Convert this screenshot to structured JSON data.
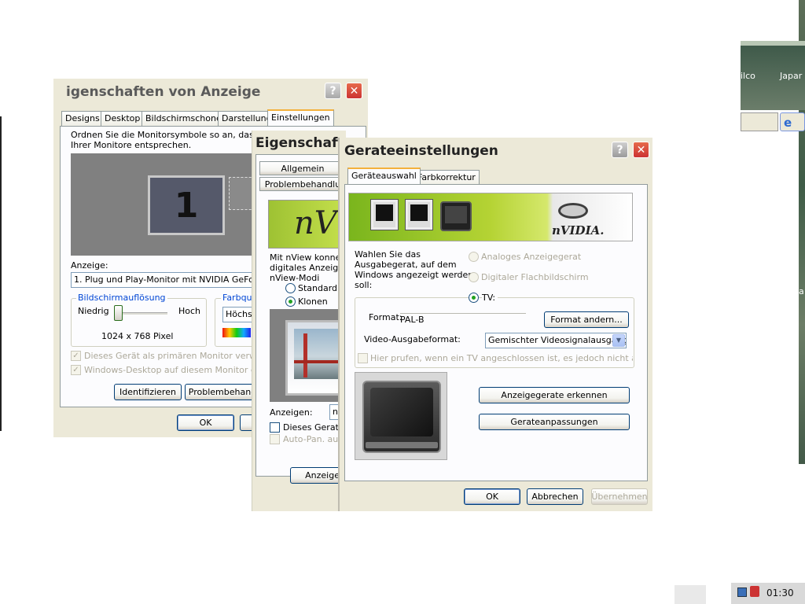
{
  "background": {
    "window_labels": [
      "ilco",
      "Japar"
    ],
    "side_char": "a"
  },
  "display_props": {
    "title": "igenschaften von Anzeige",
    "tabs": [
      "Designs",
      "Desktop",
      "Bildschirmschoner",
      "Darstellung",
      "Einstellungen"
    ],
    "active_tab": "Einstellungen",
    "instruction": "Ordnen Sie die Monitorsymbole so an, dass sie d\nIhrer Monitore entsprechen.",
    "monitor_number": "1",
    "display_label": "Anzeige:",
    "display_value": "1. Plug und Play-Monitor mit NVIDIA GeForce FX",
    "resolution_group": "Bildschirmauflösung",
    "res_low": "Niedrig",
    "res_high": "Hoch",
    "resolution_value": "1024 x 768 Pixel",
    "resolution_level": 0.35,
    "color_group": "Farbqua",
    "color_value": "Höchs",
    "check_primary": "Dieses Gerät als primären Monitor verwenden",
    "check_extend": "Windows-Desktop auf diesem Monitor erweite",
    "btn_identify": "Identifizieren",
    "btn_troubleshoot": "Problembehand",
    "btn_ok": "OK"
  },
  "nview_props": {
    "title": "Eigenschafte",
    "btn_general": "Allgemein",
    "btn_troubleshoot": "Problembehandlu",
    "logo_text": "nVie",
    "desc": "Mit nView konnen\ndigitales Anzeige\nnView-Modi",
    "radio_standard": "Standard (I",
    "radio_clone": "Klonen",
    "display_label": "Anzeigen:",
    "display_value": "n",
    "check_device": "Dieses Gerat a",
    "check_autopan": "Auto-Pan. auf",
    "btn_display": "Anzeige"
  },
  "device_settings": {
    "title": "Gerateeinstellungen",
    "tabs": [
      "Geräteauswahl",
      "Farbkorrektur"
    ],
    "active_tab": "Geräteauswahl",
    "banner_brand": "nVIDIA.",
    "prompt": "Wahlen Sie das\nAusgabegerat, auf dem\nWindows angezeigt werden\nsoll:",
    "radio_analog": "Analoges Anzeigegerat",
    "radio_digital": "Digitaler Flachbildschirm",
    "radio_tv": "TV:",
    "format_label": "Format:",
    "format_value": "PAL-B",
    "btn_change_format": "Format andern...",
    "video_out_label": "Video-Ausgabeformat:",
    "video_out_value": "Gemischter Videosignalausgang",
    "check_tv": "Hier prufen, wenn ein TV angeschlossen ist, es jedoch nicht ausgewa",
    "btn_detect": "Anzeigegerate erkennen",
    "btn_adjust": "Gerateanpassungen",
    "btn_ok": "OK",
    "btn_cancel": "Abbrechen",
    "btn_apply": "Übernehmen"
  },
  "taskbar": {
    "clock": "01:30"
  },
  "colors": {
    "dialog_bg": "#ece9d8",
    "accent_orange": "#f4b13d",
    "nvidia_green": "#76b900",
    "close_red": "#c33"
  }
}
